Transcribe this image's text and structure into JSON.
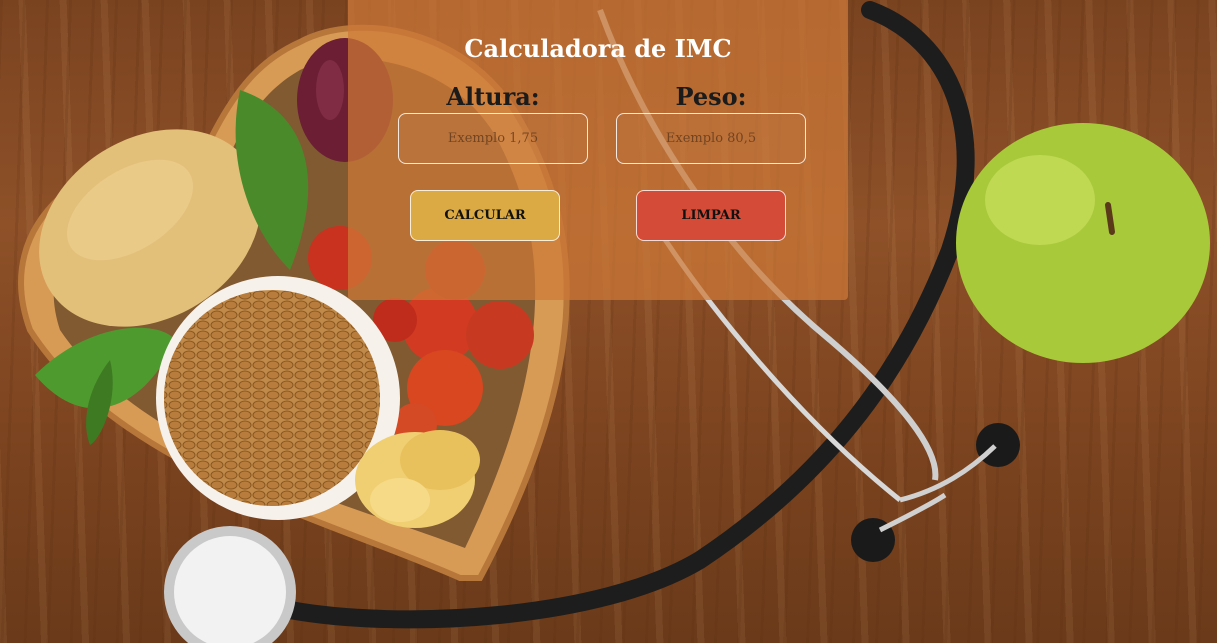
{
  "app": {
    "title": "Calculadora de IMC"
  },
  "form": {
    "height": {
      "label": "Altura:",
      "placeholder": "Exemplo 1,75",
      "value": ""
    },
    "weight": {
      "label": "Peso:",
      "placeholder": "Exemplo 80,5",
      "value": ""
    }
  },
  "actions": {
    "calculate_label": "CALCULAR",
    "clear_label": "LIMPAR"
  },
  "colors": {
    "card_overlay": "#cd7837",
    "calculate_button": "#dcaa45",
    "clear_button": "#d44b37",
    "title_text": "#ffffff",
    "label_text": "#1b1b1b"
  },
  "background": {
    "image_icon": "healthy-food-stethoscope-photo"
  }
}
